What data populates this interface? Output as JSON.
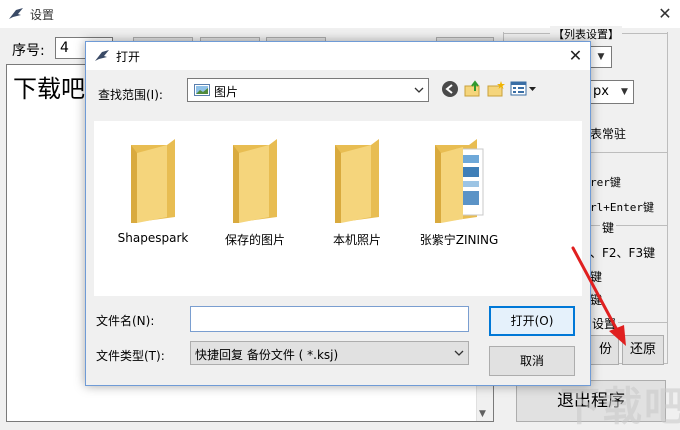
{
  "background_window": {
    "title": "设置",
    "close_symbol": "✕",
    "seq_label": "序号:",
    "seq_value": "4",
    "big_text": "下载吧",
    "group_title": "【列表设置】",
    "px_value": "px",
    "frag_always_on": "表常驻",
    "frag_enter": "rer键",
    "frag_ctrl_enter": "rl+Enter键",
    "frag_key": "键",
    "frag_fkeys": "、F2、F3键",
    "frag_key2": "键",
    "frag_key3": "键",
    "frag_settings": "设置",
    "backup_label": "份",
    "restore_label": "还原",
    "exit_label": "退出程序"
  },
  "watermark": {
    "text": "下载吧"
  },
  "dialog": {
    "title": "打开",
    "close_symbol": "✕",
    "look_in_label": "查找范围(I):",
    "look_in_value": "图片",
    "toolbar_icons": [
      "back-icon",
      "up-folder-icon",
      "new-folder-icon",
      "view-menu-icon"
    ],
    "files": [
      {
        "name": "Shapespark",
        "icon": "folder-icon"
      },
      {
        "name": "保存的图片",
        "icon": "folder-icon"
      },
      {
        "name": "本机照片",
        "icon": "folder-icon"
      },
      {
        "name": "张紫宁ZINING",
        "icon": "folder-with-files-icon"
      }
    ],
    "file_name_label": "文件名(N):",
    "file_name_value": "",
    "file_type_label": "文件类型(T):",
    "file_type_value": "快捷回复 备份文件 ( *.ksj)",
    "open_label": "打开(O)",
    "cancel_label": "取消"
  },
  "colors": {
    "folder": "#f5d57c",
    "folder_dark": "#e8bd52",
    "accent_border": "#0078d7",
    "annotation_arrow": "#e02020"
  }
}
